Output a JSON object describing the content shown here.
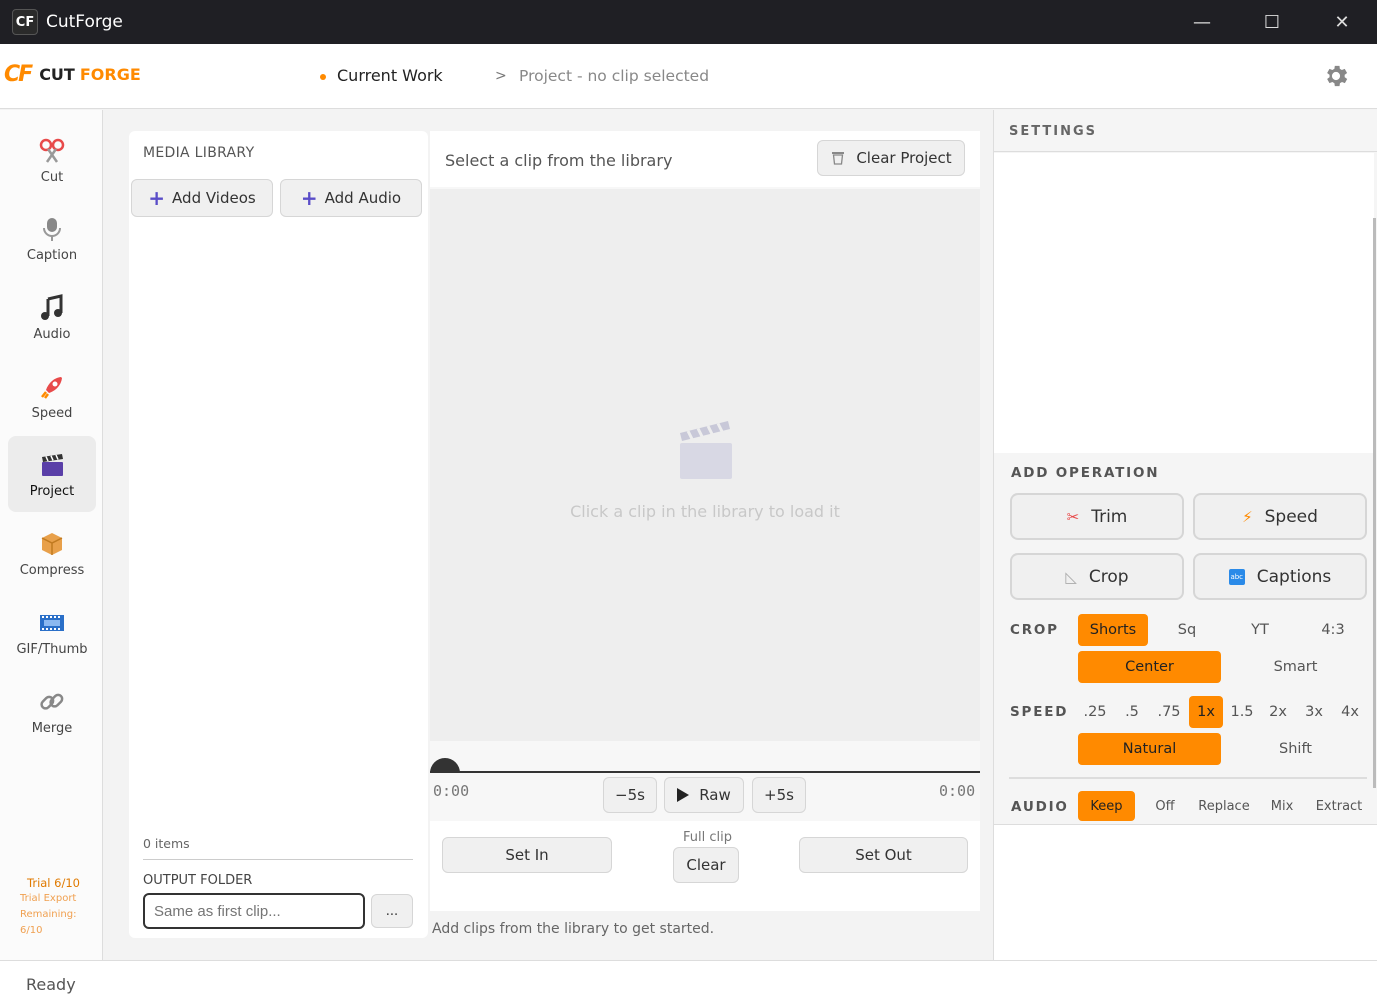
{
  "window": {
    "title": "CutForge",
    "minimize": "—",
    "maximize": "☐",
    "close": "✕"
  },
  "header": {
    "logo_mark": "CF",
    "logo_cut": "CUT",
    "logo_forge": "FORGE",
    "current": "Current Work",
    "separator": ">",
    "crumb": "Project - no clip selected"
  },
  "sidebar": {
    "items": [
      {
        "label": "Cut",
        "icon": "scissors-icon"
      },
      {
        "label": "Caption",
        "icon": "microphone-icon"
      },
      {
        "label": "Audio",
        "icon": "music-note-icon"
      },
      {
        "label": "Speed",
        "icon": "rocket-icon"
      },
      {
        "label": "Project",
        "icon": "clapperboard-icon"
      },
      {
        "label": "Compress",
        "icon": "package-icon"
      },
      {
        "label": "GIF/Thumb",
        "icon": "film-icon"
      },
      {
        "label": "Merge",
        "icon": "link-icon"
      }
    ],
    "trial": {
      "line1": "Trial 6/10",
      "line2": "Trial Export",
      "line3": "Remaining:",
      "line4": "6/10"
    }
  },
  "media": {
    "title": "MEDIA LIBRARY",
    "add_videos": "Add Videos",
    "add_audio": "Add Audio",
    "count": "0 items",
    "output_label": "OUTPUT FOLDER",
    "output_placeholder": "Same as first clip...",
    "browse": "..."
  },
  "player": {
    "select_label": "Select a clip from the library",
    "clear_project": "Clear Project",
    "hint": "Click a clip in the library to load it",
    "time_start": "0:00",
    "time_end": "0:00",
    "back": "−5s",
    "raw": "Raw",
    "forward": "+5s",
    "set_in": "Set In",
    "full_clip": "Full clip",
    "clear": "Clear",
    "set_out": "Set Out",
    "status": "Add clips from the library to get started."
  },
  "settings": {
    "title": "SETTINGS",
    "add_operation": "ADD OPERATION",
    "ops": {
      "trim": "Trim",
      "speed": "Speed",
      "crop": "Crop",
      "captions": "Captions"
    },
    "crop_label": "CROP",
    "crop_options": [
      "Shorts",
      "Sq",
      "YT",
      "4:3"
    ],
    "crop_selected": "Shorts",
    "crop_mode": [
      "Center",
      "Smart"
    ],
    "speed_label": "SPEED",
    "speed_options": [
      ".25",
      ".5",
      ".75",
      "1x",
      "1.5",
      "2x",
      "3x",
      "4x"
    ],
    "speed_selected": "1x",
    "speed_mode": [
      "Natural",
      "Shift"
    ],
    "audio_label": "AUDIO",
    "audio_options": [
      "Keep",
      "Off",
      "Replace",
      "Mix",
      "Extract"
    ],
    "audio_selected": "Keep",
    "accent": "#ff8a00"
  },
  "statusbar": {
    "text": "Ready"
  }
}
